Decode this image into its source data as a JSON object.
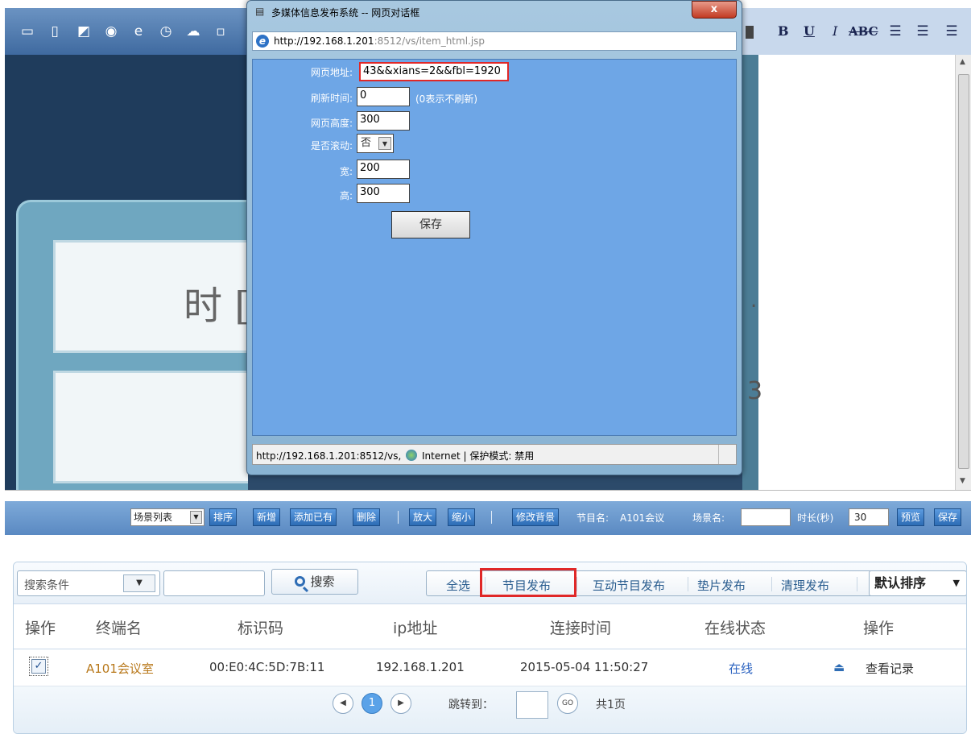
{
  "toolbar": {
    "format_buttons": [
      "B",
      "U",
      "I",
      "ABC"
    ]
  },
  "canvas": {
    "time_text": "时 [",
    "right_fragments": [
      ".",
      "3",
      "。"
    ]
  },
  "bottombar": {
    "scene_list": "场景列表",
    "btn_sort": "排序",
    "btn_new": "新增",
    "btn_add_existing": "添加已有",
    "btn_delete": "删除",
    "btn_zoom_in": "放大",
    "btn_zoom_out": "缩小",
    "btn_change_bg": "修改背景",
    "program_name_label": "节目名:",
    "program_name_value": "A101会议",
    "scene_name_label": "场景名:",
    "duration_label": "时长(秒)",
    "duration_value": "30",
    "btn_preview": "预览",
    "btn_save": "保存"
  },
  "dialog": {
    "title": "多媒体信息发布系统 -- 网页对话框",
    "close": "x",
    "address_host": "http://192.168.1.201",
    "address_rest": ":8512/vs/item_html.jsp",
    "fields": {
      "url_label": "网页地址:",
      "url_value": "43&&xians=2&&fbl=1920",
      "refresh_label": "刷新时间:",
      "refresh_value": "0",
      "refresh_note": "(0表示不刷新)",
      "height_label": "网页高度:",
      "height_value": "300",
      "scroll_label": "是否滚动:",
      "scroll_value": "否",
      "width_label": "宽:",
      "width_value": "200",
      "h_label": "高:",
      "h_value": "300"
    },
    "save": "保存",
    "status_url": "http://192.168.1.201:8512/vs,",
    "status_zone": "Internet | 保护模式: 禁用"
  },
  "filter": {
    "condition": "搜索条件",
    "search": "搜索",
    "select_all": "全选",
    "publish_program": "节目发布",
    "publish_interactive": "互动节目发布",
    "publish_filler": "垫片发布",
    "clear_publish": "清理发布",
    "sort": "默认排序"
  },
  "table": {
    "headers": [
      "操作",
      "终端名",
      "标识码",
      "ip地址",
      "连接时间",
      "在线状态",
      "操作"
    ],
    "rows": [
      {
        "name": "A101会议室",
        "id": "00:E0:4C:5D:7B:11",
        "ip": "192.168.1.201",
        "time": "2015-05-04 11:50:27",
        "status": "在线",
        "action": "查看记录"
      }
    ]
  },
  "pager": {
    "current_page": "1",
    "goto_label": "跳转到：",
    "go": "GO",
    "total": "共1页"
  },
  "colors": {
    "highlight_red": "#e02828",
    "dialog_body": "#6ea6e6",
    "toolbar_blue": "#3f6aa0",
    "accent_blue": "#2a62c0"
  }
}
